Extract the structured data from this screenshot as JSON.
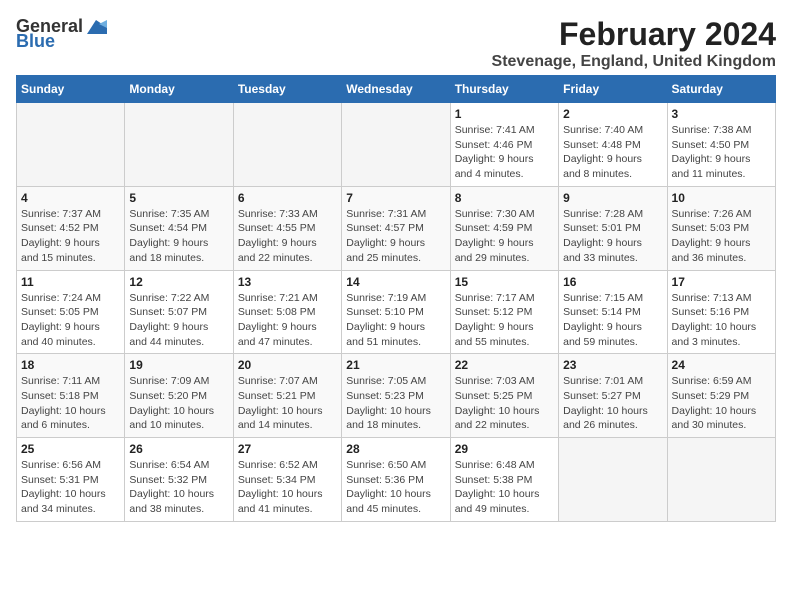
{
  "logo": {
    "general": "General",
    "blue": "Blue"
  },
  "title": "February 2024",
  "subtitle": "Stevenage, England, United Kingdom",
  "days_header": [
    "Sunday",
    "Monday",
    "Tuesday",
    "Wednesday",
    "Thursday",
    "Friday",
    "Saturday"
  ],
  "weeks": [
    [
      {
        "day": "",
        "info": ""
      },
      {
        "day": "",
        "info": ""
      },
      {
        "day": "",
        "info": ""
      },
      {
        "day": "",
        "info": ""
      },
      {
        "day": "1",
        "info": "Sunrise: 7:41 AM\nSunset: 4:46 PM\nDaylight: 9 hours\nand 4 minutes."
      },
      {
        "day": "2",
        "info": "Sunrise: 7:40 AM\nSunset: 4:48 PM\nDaylight: 9 hours\nand 8 minutes."
      },
      {
        "day": "3",
        "info": "Sunrise: 7:38 AM\nSunset: 4:50 PM\nDaylight: 9 hours\nand 11 minutes."
      }
    ],
    [
      {
        "day": "4",
        "info": "Sunrise: 7:37 AM\nSunset: 4:52 PM\nDaylight: 9 hours\nand 15 minutes."
      },
      {
        "day": "5",
        "info": "Sunrise: 7:35 AM\nSunset: 4:54 PM\nDaylight: 9 hours\nand 18 minutes."
      },
      {
        "day": "6",
        "info": "Sunrise: 7:33 AM\nSunset: 4:55 PM\nDaylight: 9 hours\nand 22 minutes."
      },
      {
        "day": "7",
        "info": "Sunrise: 7:31 AM\nSunset: 4:57 PM\nDaylight: 9 hours\nand 25 minutes."
      },
      {
        "day": "8",
        "info": "Sunrise: 7:30 AM\nSunset: 4:59 PM\nDaylight: 9 hours\nand 29 minutes."
      },
      {
        "day": "9",
        "info": "Sunrise: 7:28 AM\nSunset: 5:01 PM\nDaylight: 9 hours\nand 33 minutes."
      },
      {
        "day": "10",
        "info": "Sunrise: 7:26 AM\nSunset: 5:03 PM\nDaylight: 9 hours\nand 36 minutes."
      }
    ],
    [
      {
        "day": "11",
        "info": "Sunrise: 7:24 AM\nSunset: 5:05 PM\nDaylight: 9 hours\nand 40 minutes."
      },
      {
        "day": "12",
        "info": "Sunrise: 7:22 AM\nSunset: 5:07 PM\nDaylight: 9 hours\nand 44 minutes."
      },
      {
        "day": "13",
        "info": "Sunrise: 7:21 AM\nSunset: 5:08 PM\nDaylight: 9 hours\nand 47 minutes."
      },
      {
        "day": "14",
        "info": "Sunrise: 7:19 AM\nSunset: 5:10 PM\nDaylight: 9 hours\nand 51 minutes."
      },
      {
        "day": "15",
        "info": "Sunrise: 7:17 AM\nSunset: 5:12 PM\nDaylight: 9 hours\nand 55 minutes."
      },
      {
        "day": "16",
        "info": "Sunrise: 7:15 AM\nSunset: 5:14 PM\nDaylight: 9 hours\nand 59 minutes."
      },
      {
        "day": "17",
        "info": "Sunrise: 7:13 AM\nSunset: 5:16 PM\nDaylight: 10 hours\nand 3 minutes."
      }
    ],
    [
      {
        "day": "18",
        "info": "Sunrise: 7:11 AM\nSunset: 5:18 PM\nDaylight: 10 hours\nand 6 minutes."
      },
      {
        "day": "19",
        "info": "Sunrise: 7:09 AM\nSunset: 5:20 PM\nDaylight: 10 hours\nand 10 minutes."
      },
      {
        "day": "20",
        "info": "Sunrise: 7:07 AM\nSunset: 5:21 PM\nDaylight: 10 hours\nand 14 minutes."
      },
      {
        "day": "21",
        "info": "Sunrise: 7:05 AM\nSunset: 5:23 PM\nDaylight: 10 hours\nand 18 minutes."
      },
      {
        "day": "22",
        "info": "Sunrise: 7:03 AM\nSunset: 5:25 PM\nDaylight: 10 hours\nand 22 minutes."
      },
      {
        "day": "23",
        "info": "Sunrise: 7:01 AM\nSunset: 5:27 PM\nDaylight: 10 hours\nand 26 minutes."
      },
      {
        "day": "24",
        "info": "Sunrise: 6:59 AM\nSunset: 5:29 PM\nDaylight: 10 hours\nand 30 minutes."
      }
    ],
    [
      {
        "day": "25",
        "info": "Sunrise: 6:56 AM\nSunset: 5:31 PM\nDaylight: 10 hours\nand 34 minutes."
      },
      {
        "day": "26",
        "info": "Sunrise: 6:54 AM\nSunset: 5:32 PM\nDaylight: 10 hours\nand 38 minutes."
      },
      {
        "day": "27",
        "info": "Sunrise: 6:52 AM\nSunset: 5:34 PM\nDaylight: 10 hours\nand 41 minutes."
      },
      {
        "day": "28",
        "info": "Sunrise: 6:50 AM\nSunset: 5:36 PM\nDaylight: 10 hours\nand 45 minutes."
      },
      {
        "day": "29",
        "info": "Sunrise: 6:48 AM\nSunset: 5:38 PM\nDaylight: 10 hours\nand 49 minutes."
      },
      {
        "day": "",
        "info": ""
      },
      {
        "day": "",
        "info": ""
      }
    ]
  ]
}
